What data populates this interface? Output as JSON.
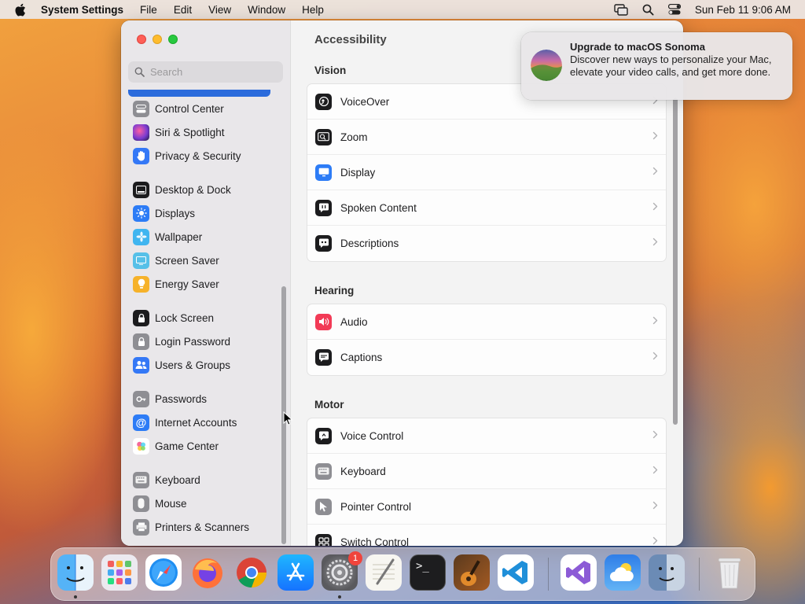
{
  "menubar": {
    "app": "System Settings",
    "menus": [
      "File",
      "Edit",
      "View",
      "Window",
      "Help"
    ],
    "datetime": "Sun Feb 11  9:06 AM"
  },
  "sidebar": {
    "search_placeholder": "Search",
    "items": [
      {
        "label": "Control Center",
        "icon": "control-center-icon",
        "color": "#8e8e93"
      },
      {
        "label": "Siri & Spotlight",
        "icon": "siri-icon",
        "color": "#b5338d"
      },
      {
        "label": "Privacy & Security",
        "icon": "hand-icon",
        "color": "#3478f6"
      },
      {
        "label": "Desktop & Dock",
        "icon": "dock-icon",
        "color": "#1c1c1e"
      },
      {
        "label": "Displays",
        "icon": "sun-icon",
        "color": "#2d7cf6"
      },
      {
        "label": "Wallpaper",
        "icon": "flower-icon",
        "color": "#40b5f0"
      },
      {
        "label": "Screen Saver",
        "icon": "screen-saver-icon",
        "color": "#56c0e8"
      },
      {
        "label": "Energy Saver",
        "icon": "bulb-icon",
        "color": "#f6b22a"
      },
      {
        "label": "Lock Screen",
        "icon": "lock-icon",
        "color": "#1c1c1e"
      },
      {
        "label": "Login Password",
        "icon": "lock-icon",
        "color": "#8e8e93"
      },
      {
        "label": "Users & Groups",
        "icon": "users-icon",
        "color": "#3478f6"
      },
      {
        "label": "Passwords",
        "icon": "key-icon",
        "color": "#8e8e93"
      },
      {
        "label": "Internet Accounts",
        "icon": "at-icon",
        "color": "#2d7cf6"
      },
      {
        "label": "Game Center",
        "icon": "game-center-icon",
        "color": "#ffffff"
      },
      {
        "label": "Keyboard",
        "icon": "keyboard-icon",
        "color": "#8e8e93"
      },
      {
        "label": "Mouse",
        "icon": "mouse-icon",
        "color": "#8e8e93"
      },
      {
        "label": "Printers & Scanners",
        "icon": "printer-icon",
        "color": "#8e8e93"
      }
    ]
  },
  "main": {
    "title": "Accessibility",
    "sections": [
      {
        "title": "Vision",
        "rows": [
          {
            "label": "VoiceOver",
            "icon": "voiceover-icon",
            "color": "#1c1c1e"
          },
          {
            "label": "Zoom",
            "icon": "zoom-icon",
            "color": "#1c1c1e"
          },
          {
            "label": "Display",
            "icon": "display-icon",
            "color": "#2d7cf6"
          },
          {
            "label": "Spoken Content",
            "icon": "speech-bubble-icon",
            "color": "#1c1c1e"
          },
          {
            "label": "Descriptions",
            "icon": "quote-bubble-icon",
            "color": "#1c1c1e"
          }
        ]
      },
      {
        "title": "Hearing",
        "rows": [
          {
            "label": "Audio",
            "icon": "speaker-icon",
            "color": "#f23a56"
          },
          {
            "label": "Captions",
            "icon": "captions-icon",
            "color": "#1c1c1e"
          }
        ]
      },
      {
        "title": "Motor",
        "rows": [
          {
            "label": "Voice Control",
            "icon": "voice-control-icon",
            "color": "#1c1c1e"
          },
          {
            "label": "Keyboard",
            "icon": "keyboard-icon",
            "color": "#8e8e93"
          },
          {
            "label": "Pointer Control",
            "icon": "pointer-icon",
            "color": "#8e8e93"
          },
          {
            "label": "Switch Control",
            "icon": "switch-control-icon",
            "color": "#1c1c1e"
          }
        ]
      }
    ]
  },
  "notification": {
    "title": "Upgrade to macOS Sonoma",
    "body": "Discover new ways to personalize your Mac, elevate your video calls, and get more done."
  },
  "dock": {
    "apps": [
      "finder",
      "launchpad",
      "safari",
      "firefox",
      "chrome",
      "app-store",
      "system-settings",
      "script-editor",
      "terminal",
      "garageband",
      "vscode",
      "visual-studio",
      "weather",
      "migration-assistant",
      "trash"
    ],
    "settings_badge": "1"
  }
}
